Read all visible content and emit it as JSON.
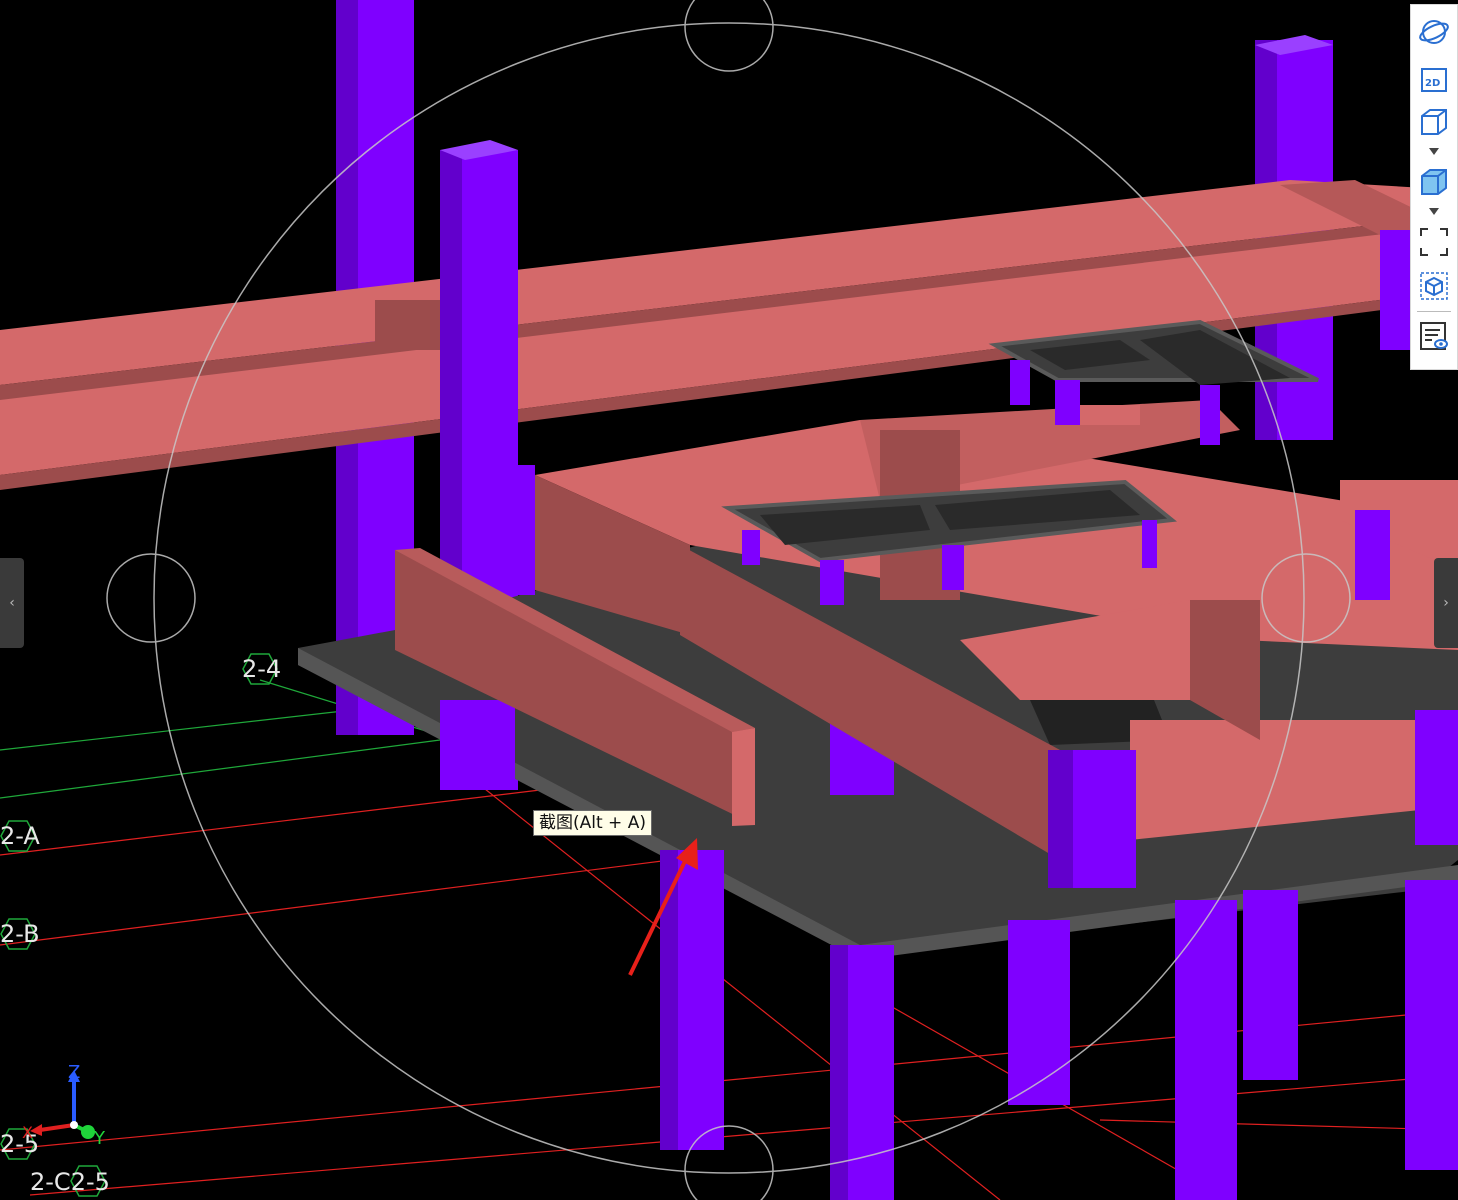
{
  "viewport": {
    "grid_labels": {
      "label_2_4": "2-4",
      "label_2_A": "2-A",
      "label_2_B": "2-B",
      "label_2_5": "2-5",
      "label_2_C2_5": "2-C2-5"
    },
    "axes": {
      "x": "X",
      "y": "Y",
      "z": "Z"
    },
    "colors": {
      "background": "#000000",
      "column": "#7f00ff",
      "beam_top": "#d4696a",
      "beam_side": "#9c4c4c",
      "slab": "#3d3d3d",
      "grid_red": "#e02020",
      "grid_green": "#1fa83a",
      "orbit_ring": "#c8c8c8"
    }
  },
  "tooltip": {
    "text": "截图(Alt + A)"
  },
  "side_tabs": {
    "left_icon": "chevron-left-icon",
    "right_icon": "chevron-right-icon"
  },
  "toolbar": {
    "items": [
      {
        "icon": "orbit-icon"
      },
      {
        "icon": "view-2d-icon",
        "label": "2D"
      },
      {
        "icon": "wireframe-cube-icon"
      },
      {
        "icon": "solid-cube-icon"
      },
      {
        "icon": "fit-view-icon"
      },
      {
        "icon": "isolate-cube-icon"
      },
      {
        "icon": "properties-view-icon"
      }
    ]
  }
}
